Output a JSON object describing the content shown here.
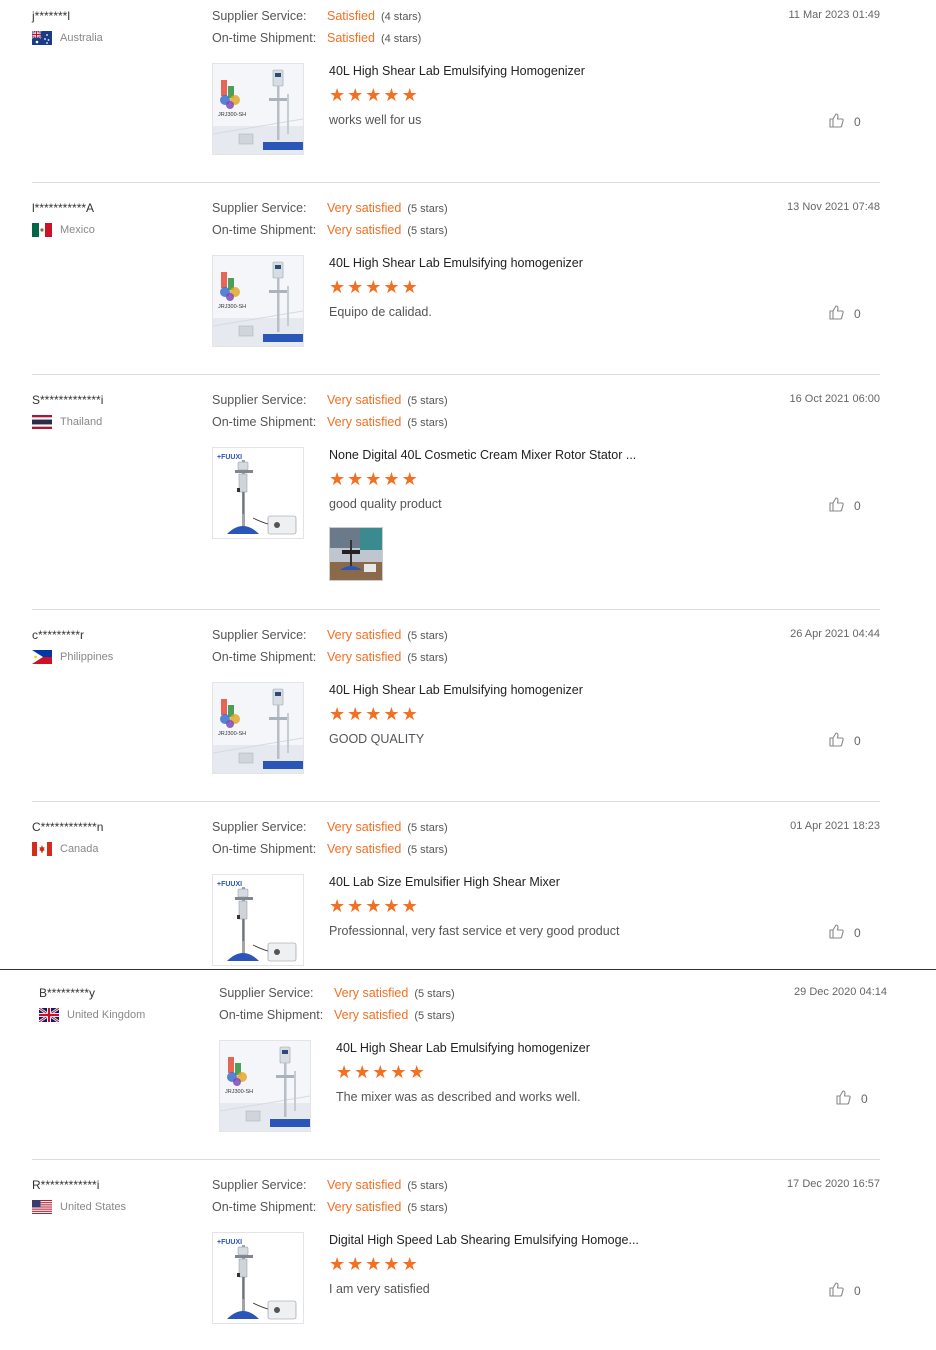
{
  "reviews": [
    {
      "buyer": "j*******l",
      "country": "Australia",
      "flag": "au",
      "supplier_label": "Supplier Service:",
      "supplier_value": "Satisfied",
      "supplier_stars": "(4 stars)",
      "shipment_label": "On-time Shipment:",
      "shipment_value": "Satisfied",
      "shipment_stars": "(4 stars)",
      "date": "11 Mar 2023 01:49",
      "product_title": "40L High Shear Lab Emulsifying Homogenizer",
      "product_image": "jrj300-sh",
      "image_caption": "JRJ300-SH",
      "comment": "works well for us",
      "helpful": "0",
      "rating": 5
    },
    {
      "buyer": "l***********A",
      "country": "Mexico",
      "flag": "mx",
      "supplier_label": "Supplier Service:",
      "supplier_value": "Very satisfied",
      "supplier_stars": "(5 stars)",
      "shipment_label": "On-time Shipment:",
      "shipment_value": "Very satisfied",
      "shipment_stars": "(5 stars)",
      "date": "13 Nov 2021 07:48",
      "product_title": "40L High Shear Lab Emulsifying homogenizer",
      "product_image": "jrj300-sh",
      "image_caption": "JRJ300-SH",
      "comment": "Equipo de calidad.",
      "helpful": "0",
      "rating": 5
    },
    {
      "buyer": "S*************i",
      "country": "Thailand",
      "flag": "th",
      "supplier_label": "Supplier Service:",
      "supplier_value": "Very satisfied",
      "supplier_stars": "(5 stars)",
      "shipment_label": "On-time Shipment:",
      "shipment_value": "Very satisfied",
      "shipment_stars": "(5 stars)",
      "date": "16 Oct 2021 06:00",
      "product_title": "None Digital 40L Cosmetic Cream Mixer Rotor Stator ...",
      "product_image": "fluxi-mixer",
      "image_caption": "FLUXI",
      "comment": "good quality product",
      "helpful": "0",
      "rating": 5,
      "has_photo": true
    },
    {
      "buyer": "c*********r",
      "country": "Philippines",
      "flag": "ph",
      "supplier_label": "Supplier Service:",
      "supplier_value": "Very satisfied",
      "supplier_stars": "(5 stars)",
      "shipment_label": "On-time Shipment:",
      "shipment_value": "Very satisfied",
      "shipment_stars": "(5 stars)",
      "date": "26 Apr 2021 04:44",
      "product_title": "40L High Shear Lab Emulsifying homogenizer",
      "product_image": "jrj300-sh",
      "image_caption": "JRJ300-SH",
      "comment": "GOOD QUALITY",
      "helpful": "0",
      "rating": 5
    },
    {
      "buyer": "C************n",
      "country": "Canada",
      "flag": "ca",
      "supplier_label": "Supplier Service:",
      "supplier_value": "Very satisfied",
      "supplier_stars": "(5 stars)",
      "shipment_label": "On-time Shipment:",
      "shipment_value": "Very satisfied",
      "shipment_stars": "(5 stars)",
      "date": "01 Apr 2021 18:23",
      "product_title": "40L Lab Size Emulsifier High Shear Mixer",
      "product_image": "fluxi-mixer",
      "image_caption": "FLUXI",
      "comment": "Professionnal, very fast service et very good product",
      "helpful": "0",
      "rating": 5
    },
    {
      "buyer": "B*********y",
      "country": "United Kingdom",
      "flag": "gb",
      "supplier_label": "Supplier Service:",
      "supplier_value": "Very satisfied",
      "supplier_stars": "(5 stars)",
      "shipment_label": "On-time Shipment:",
      "shipment_value": "Very satisfied",
      "shipment_stars": "(5 stars)",
      "date": "29 Dec 2020 04:14",
      "product_title": "40L High Shear Lab Emulsifying homogenizer",
      "product_image": "jrj300-sh",
      "image_caption": "JRJ300-SH",
      "comment": "The mixer was as described and works well.",
      "helpful": "0",
      "rating": 5
    },
    {
      "buyer": "R************i",
      "country": "United States",
      "flag": "us",
      "supplier_label": "Supplier Service:",
      "supplier_value": "Very satisfied",
      "supplier_stars": "(5 stars)",
      "shipment_label": "On-time Shipment:",
      "shipment_value": "Very satisfied",
      "shipment_stars": "(5 stars)",
      "date": "17 Dec 2020 16:57",
      "product_title": "Digital High Speed Lab Shearing Emulsifying Homoge...",
      "product_image": "fluxi-mixer",
      "image_caption": "FLUXI",
      "comment": "I am very satisfied",
      "helpful": "0",
      "rating": 5
    }
  ],
  "colors": {
    "accent": "#f36f21",
    "label": "#555555",
    "divider": "#dcdcdc"
  },
  "icons": {
    "helpful": "thumbs-up-icon",
    "star": "star-icon"
  }
}
